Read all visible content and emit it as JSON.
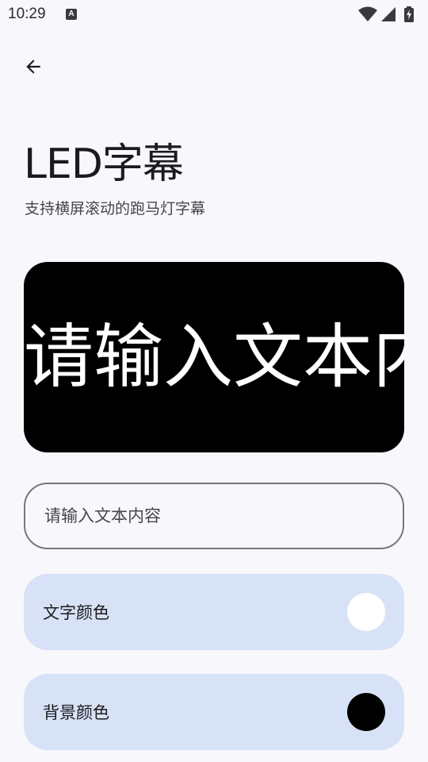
{
  "status": {
    "time": "10:29",
    "notification_glyph": "A"
  },
  "header": {
    "title": "LED字幕",
    "subtitle": "支持横屏滚动的跑马灯字幕"
  },
  "preview": {
    "text": "请输入文本内容",
    "background": "#000000",
    "text_color": "#ffffff"
  },
  "input": {
    "placeholder": "请输入文本内容",
    "value": ""
  },
  "settings": {
    "text_color_label": "文字颜色",
    "text_color_value": "#ffffff",
    "bg_color_label": "背景颜色",
    "bg_color_value": "#000000"
  },
  "colors": {
    "card": "#d8e2f6",
    "page": "#f8f8fc"
  }
}
